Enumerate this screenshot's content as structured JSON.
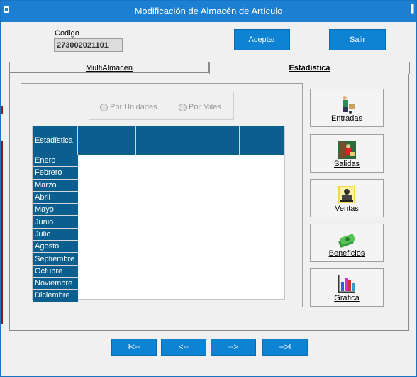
{
  "window": {
    "title": "Modificación de Almacén de Artículo"
  },
  "codigo": {
    "label": "Codigo",
    "value": "273002021101"
  },
  "actions": {
    "aceptar": "Aceptar",
    "salir": "Salir"
  },
  "tabs": [
    {
      "label": "MultiAlmacen",
      "active": false
    },
    {
      "label": "Estadística",
      "active": true
    }
  ],
  "radio": {
    "unidades": "Por Unidades",
    "miles": "Por Miles"
  },
  "grid": {
    "header": "Estadística",
    "months": [
      "Enero",
      "Febrero",
      "Marzo",
      "Abril",
      "Mayo",
      "Junio",
      "Julio",
      "Agosto",
      "Septiembre",
      "Octubre",
      "Noviembre",
      "Diciembre"
    ]
  },
  "side_buttons": [
    {
      "label": "Entradas",
      "icon": "entradas-icon"
    },
    {
      "label": "Salidas",
      "icon": "salidas-icon"
    },
    {
      "label": "Ventas",
      "icon": "ventas-icon"
    },
    {
      "label": "Beneficios",
      "icon": "beneficios-icon"
    },
    {
      "label": "Grafica",
      "icon": "grafica-icon"
    }
  ],
  "nav": {
    "first": "I<--",
    "prev": "<--",
    "next": "-->",
    "last": "-->I"
  },
  "colors": {
    "titlebar": "#1d7fd1",
    "button": "#0e83d4",
    "grid_header": "#0b5f8e"
  }
}
